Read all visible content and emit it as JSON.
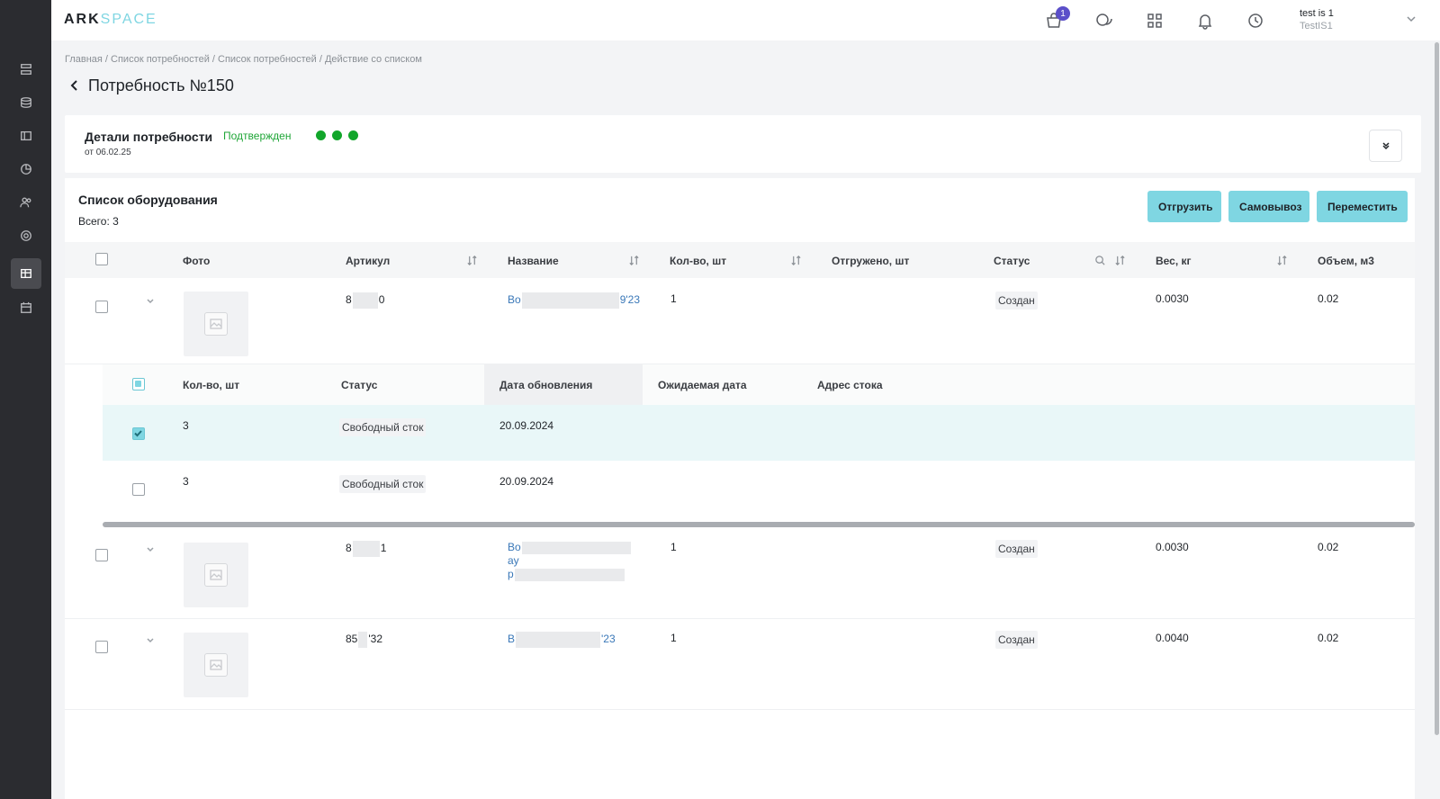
{
  "app": {
    "logo_main": "ARK",
    "logo_accent": "SPACE"
  },
  "header": {
    "cart_badge": "1",
    "user_name": "test is 1",
    "user_org": "TestIS1"
  },
  "sidebar": {
    "items": [
      {
        "icon": "server-list-icon"
      },
      {
        "icon": "database-icon"
      },
      {
        "icon": "panel-icon"
      },
      {
        "icon": "chart-icon"
      },
      {
        "icon": "users-icon"
      },
      {
        "icon": "settings-icon"
      },
      {
        "icon": "table-edit-icon",
        "active": true
      },
      {
        "icon": "calendar-icon"
      }
    ]
  },
  "breadcrumb": "Главная / Список потребностей / Список потребностей / Действие со списком",
  "page": {
    "title": "Потребность №150"
  },
  "details": {
    "title": "Детали потребности",
    "date": "от 06.02.25",
    "status": "Подтвержден",
    "status_color": "#1fa637"
  },
  "equipment": {
    "title": "Список оборудования",
    "total": "Всего: 3",
    "actions": {
      "ship": "Отгрузить",
      "pickup": "Самовывоз",
      "move": "Переместить"
    },
    "columns": {
      "photo": "Фото",
      "article": "Артикул",
      "name": "Название",
      "qty": "Кол-во, шт",
      "shipped": "Отгружено, шт",
      "status": "Статус",
      "weight": "Вес, кг",
      "volume": "Объем, м3"
    },
    "rows": [
      {
        "article_a": "8",
        "article_b": "0",
        "name_a": "Во",
        "name_b": "9'23",
        "name_c": "",
        "qty": "1",
        "status": "Создан",
        "weight": "0.0030",
        "volume": "0.02"
      },
      {
        "article_a": "8",
        "article_b": "1",
        "name_a": "Во",
        "name_b": "ay",
        "name_c": "p",
        "qty": "1",
        "status": "Создан",
        "weight": "0.0030",
        "volume": "0.02"
      },
      {
        "article_a": "85",
        "article_b": "'32",
        "name_a": "В",
        "name_b": "'23",
        "name_c": "",
        "qty": "1",
        "status": "Создан",
        "weight": "0.0040",
        "volume": "0.02"
      }
    ],
    "sub_table": {
      "columns": {
        "qty": "Кол-во, шт",
        "status": "Статус",
        "updated": "Дата обновления",
        "expected": "Ожидаемая дата",
        "address": "Адрес стока"
      },
      "rows": [
        {
          "qty": "3",
          "status": "Свободный сток",
          "updated": "20.09.2024",
          "selected": true
        },
        {
          "qty": "3",
          "status": "Свободный сток",
          "updated": "20.09.2024",
          "selected": false
        }
      ]
    }
  }
}
